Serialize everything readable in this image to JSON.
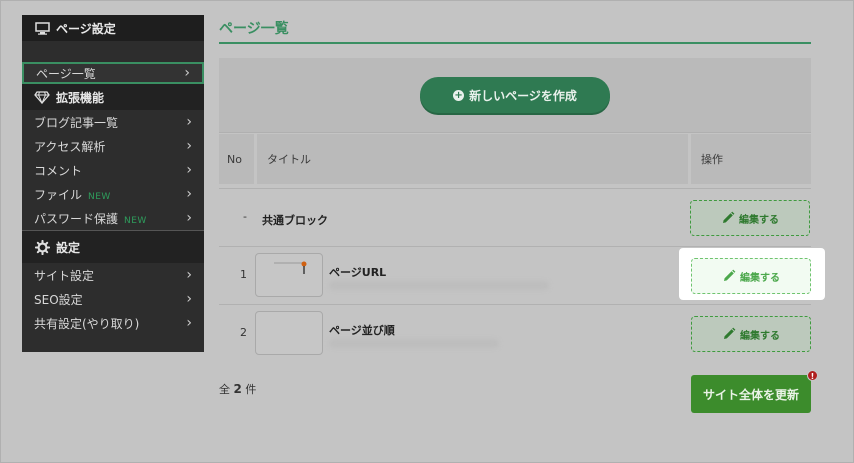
{
  "sidebar": {
    "page_settings_header": "ページ設定",
    "extensions_header": "拡張機能",
    "settings_header": "設定",
    "new_tag": "NEW",
    "page_items": [
      {
        "label": "ページ一覧"
      }
    ],
    "extension_items": [
      {
        "label": "ブログ記事一覧"
      },
      {
        "label": "アクセス解析"
      },
      {
        "label": "コメント"
      },
      {
        "label": "ファイル"
      },
      {
        "label": "パスワード保護"
      }
    ],
    "settings_items": [
      {
        "label": "サイト設定"
      },
      {
        "label": "SEO設定"
      },
      {
        "label": "共有設定(やり取り)"
      }
    ],
    "chevron": "›"
  },
  "main": {
    "title": "ページ一覧",
    "new_page_button": "新しいページを作成",
    "table": {
      "headers": {
        "no": "No",
        "title": "タイトル",
        "action": "操作"
      },
      "rows": [
        {
          "no": "-",
          "title": "共通ブロック",
          "action": "編集する"
        },
        {
          "no": "1",
          "title": "ページURL",
          "action": "編集する"
        },
        {
          "no": "2",
          "title": "ページ並び順",
          "action": "編集する"
        }
      ]
    },
    "count_prefix": "全",
    "count_value": "2",
    "count_suffix": "件",
    "update_button": "サイト全体を更新",
    "update_badge": "!"
  },
  "colors": {
    "accent_green": "#3a8f62",
    "update_green": "#3c8c2c",
    "badge_red": "#b02020"
  }
}
